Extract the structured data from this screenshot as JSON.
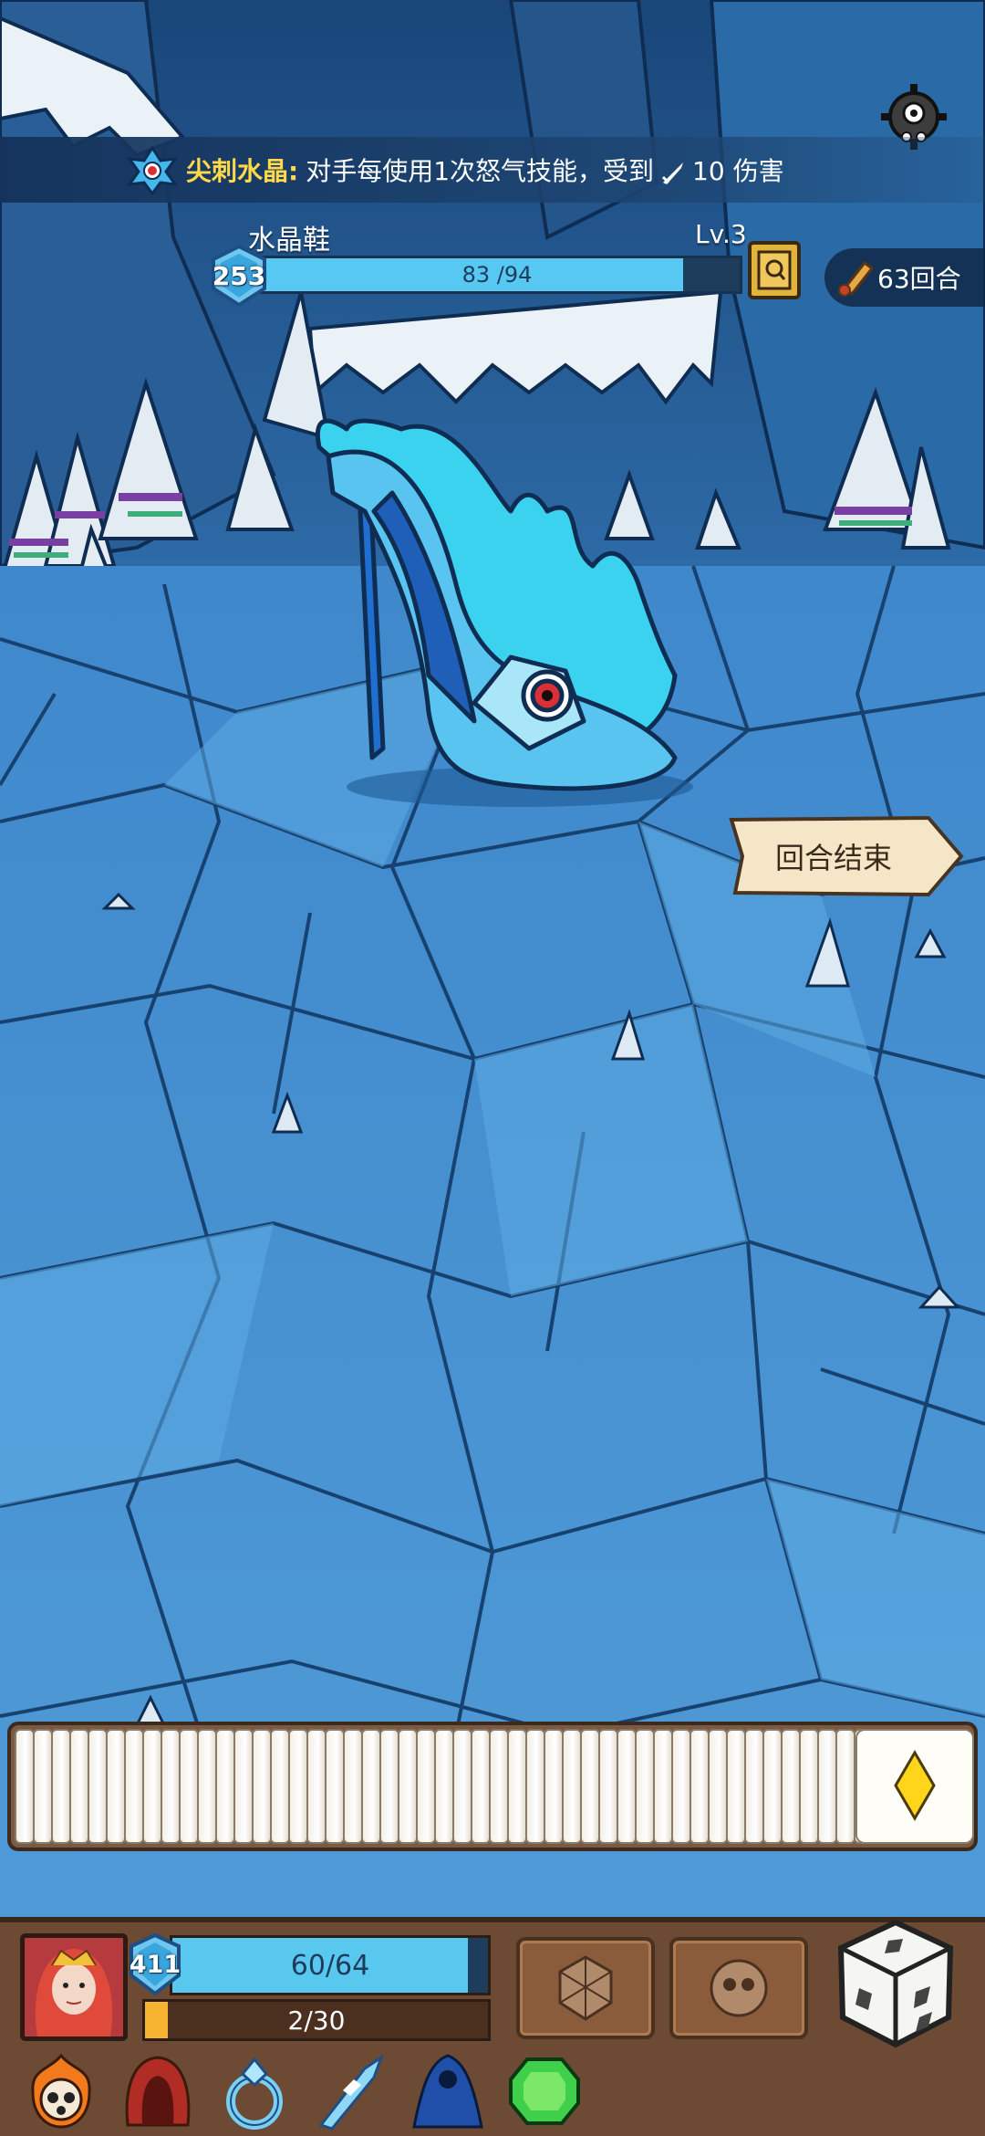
{
  "effect_banner": {
    "name": "尖刺水晶:",
    "description": "对手每使用1次怒气技能，受到",
    "damage": "10",
    "damage_suffix": "伤害"
  },
  "enemy": {
    "name": "水晶鞋",
    "level": "Lv.3",
    "shield": "253",
    "hp_current": 83,
    "hp_max": 94,
    "hp_text": "83 /94"
  },
  "turn_counter": "63回合",
  "end_turn_label": "回合结束",
  "deck": {
    "card_count": 52
  },
  "player": {
    "shield": "411",
    "hp_current": 60,
    "hp_max": 64,
    "hp_text": "60/64",
    "rage_current": 2,
    "rage_max": 30,
    "rage_text": "2/30"
  },
  "equipment": [
    "fire-skull-icon",
    "red-hood-icon",
    "crystal-ring-icon",
    "ice-blade-icon",
    "blue-cloak-icon",
    "green-gem-icon"
  ],
  "colors": {
    "hp_fill": "#59c8ef",
    "rage_fill": "#f7b431",
    "effect_name": "#ffd94a",
    "hud_wood": "#6d4a33"
  }
}
